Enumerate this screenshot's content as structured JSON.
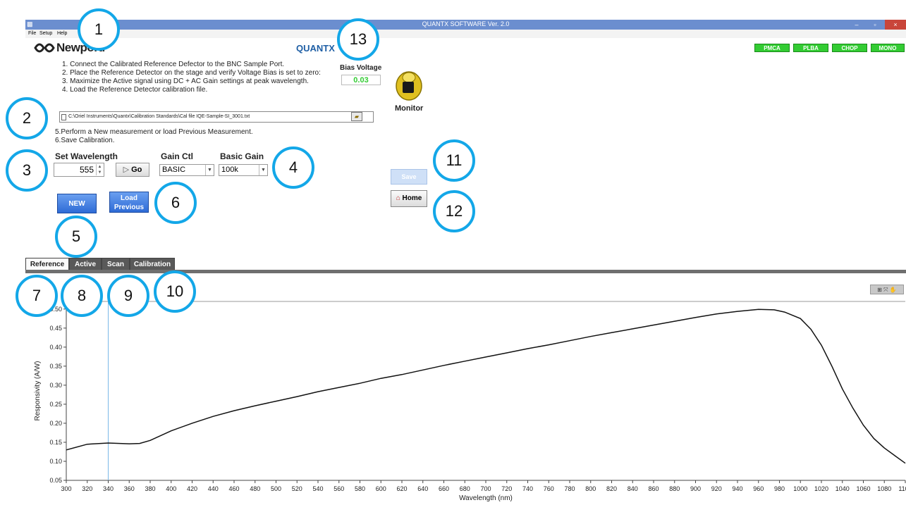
{
  "window": {
    "app_icon": "app-icon",
    "title": "QUANTX SOFTWARE Ver. 2.0",
    "minimize": "–",
    "maximize": "▫",
    "close": "×"
  },
  "menu": {
    "file": "File",
    "setup": "Setup",
    "help": "Help"
  },
  "header": {
    "logo_icon": "newport-logo-icon",
    "logo_text": "Newport.",
    "product": "QUANTX",
    "status_badges": [
      "PMCA",
      "PLBA",
      "CHOP",
      "MONO"
    ],
    "status_color": "#33cc33"
  },
  "instructions": {
    "step1": "1. Connect the Calibrated Reference Defector to the BNC Sample Port.",
    "step2": "2. Place the Reference Detector on the stage and verify Voltage Bias is set to zero:",
    "step3": "3. Maximize the Active signal using DC + AC Gain settings at peak wavelength.",
    "step4": "4. Load the Reference Detector calibration file.",
    "step5": "5.Perform a New measurement or load Previous Measurement.",
    "step6": "6.Save Calibration."
  },
  "calibration_file": {
    "path": "C:\\Oriel Instruments\\Quantx\\Calibration Standards\\Cal file IQE-Sample-SI_3001.txt",
    "doc_icon": "file-icon",
    "browse_icon": "folder-icon"
  },
  "controls": {
    "wavelength_label": "Set Wavelength",
    "wavelength_value": "555",
    "go_label": "Go",
    "go_icon": "play-icon",
    "gain_ctl_label": "Gain Ctl",
    "gain_ctl_value": "BASIC",
    "basic_gain_label": "Basic Gain",
    "basic_gain_value": "100k",
    "new_label": "NEW",
    "load_previous_label_line1": "Load",
    "load_previous_label_line2": "Previous"
  },
  "bias": {
    "label": "Bias Voltage",
    "value": "0.03"
  },
  "monitor": {
    "label": "Monitor",
    "icon": "monitor-knob-icon"
  },
  "actions": {
    "save_label": "Save",
    "home_label": "Home",
    "home_icon": "house-icon"
  },
  "tabs": [
    "Reference",
    "Active",
    "Scan",
    "Calibration"
  ],
  "graph_tools_icon": "graph-palette-icon",
  "callouts": [
    "1",
    "2",
    "3",
    "4",
    "5",
    "6",
    "7",
    "8",
    "9",
    "10",
    "11",
    "12",
    "13"
  ],
  "callout_color": "#13a7e8",
  "chart_data": {
    "type": "line",
    "title": "",
    "xlabel": "Wavelength (nm)",
    "ylabel": "Responsivity (A/W)",
    "xlim": [
      300,
      1100
    ],
    "ylim": [
      0.05,
      0.52
    ],
    "x_ticks": [
      300,
      320,
      340,
      360,
      380,
      400,
      420,
      440,
      460,
      480,
      500,
      520,
      540,
      560,
      580,
      600,
      620,
      640,
      660,
      680,
      700,
      720,
      740,
      760,
      780,
      800,
      820,
      840,
      860,
      880,
      900,
      920,
      940,
      960,
      980,
      1000,
      1020,
      1040,
      1060,
      1080,
      1100
    ],
    "y_ticks": [
      "0.05",
      "0.10",
      "0.15",
      "0.20",
      "0.25",
      "0.30",
      "0.35",
      "0.40",
      "0.45",
      "0.50"
    ],
    "cursor_x": 340,
    "grid": false,
    "series": [
      {
        "color": "#111111",
        "x": [
          300,
          320,
          340,
          360,
          370,
          380,
          400,
          420,
          440,
          460,
          480,
          500,
          520,
          540,
          560,
          580,
          600,
          620,
          640,
          660,
          680,
          700,
          720,
          740,
          760,
          780,
          800,
          820,
          840,
          860,
          880,
          900,
          920,
          940,
          960,
          975,
          985,
          1000,
          1010,
          1020,
          1030,
          1040,
          1050,
          1060,
          1070,
          1080,
          1090,
          1100
        ],
        "y": [
          0.13,
          0.145,
          0.148,
          0.146,
          0.147,
          0.155,
          0.18,
          0.2,
          0.218,
          0.233,
          0.246,
          0.258,
          0.27,
          0.283,
          0.294,
          0.305,
          0.318,
          0.328,
          0.34,
          0.352,
          0.363,
          0.374,
          0.385,
          0.396,
          0.406,
          0.417,
          0.428,
          0.438,
          0.448,
          0.458,
          0.468,
          0.478,
          0.487,
          0.494,
          0.499,
          0.498,
          0.492,
          0.475,
          0.447,
          0.405,
          0.35,
          0.29,
          0.24,
          0.195,
          0.16,
          0.135,
          0.115,
          0.095
        ]
      }
    ]
  }
}
